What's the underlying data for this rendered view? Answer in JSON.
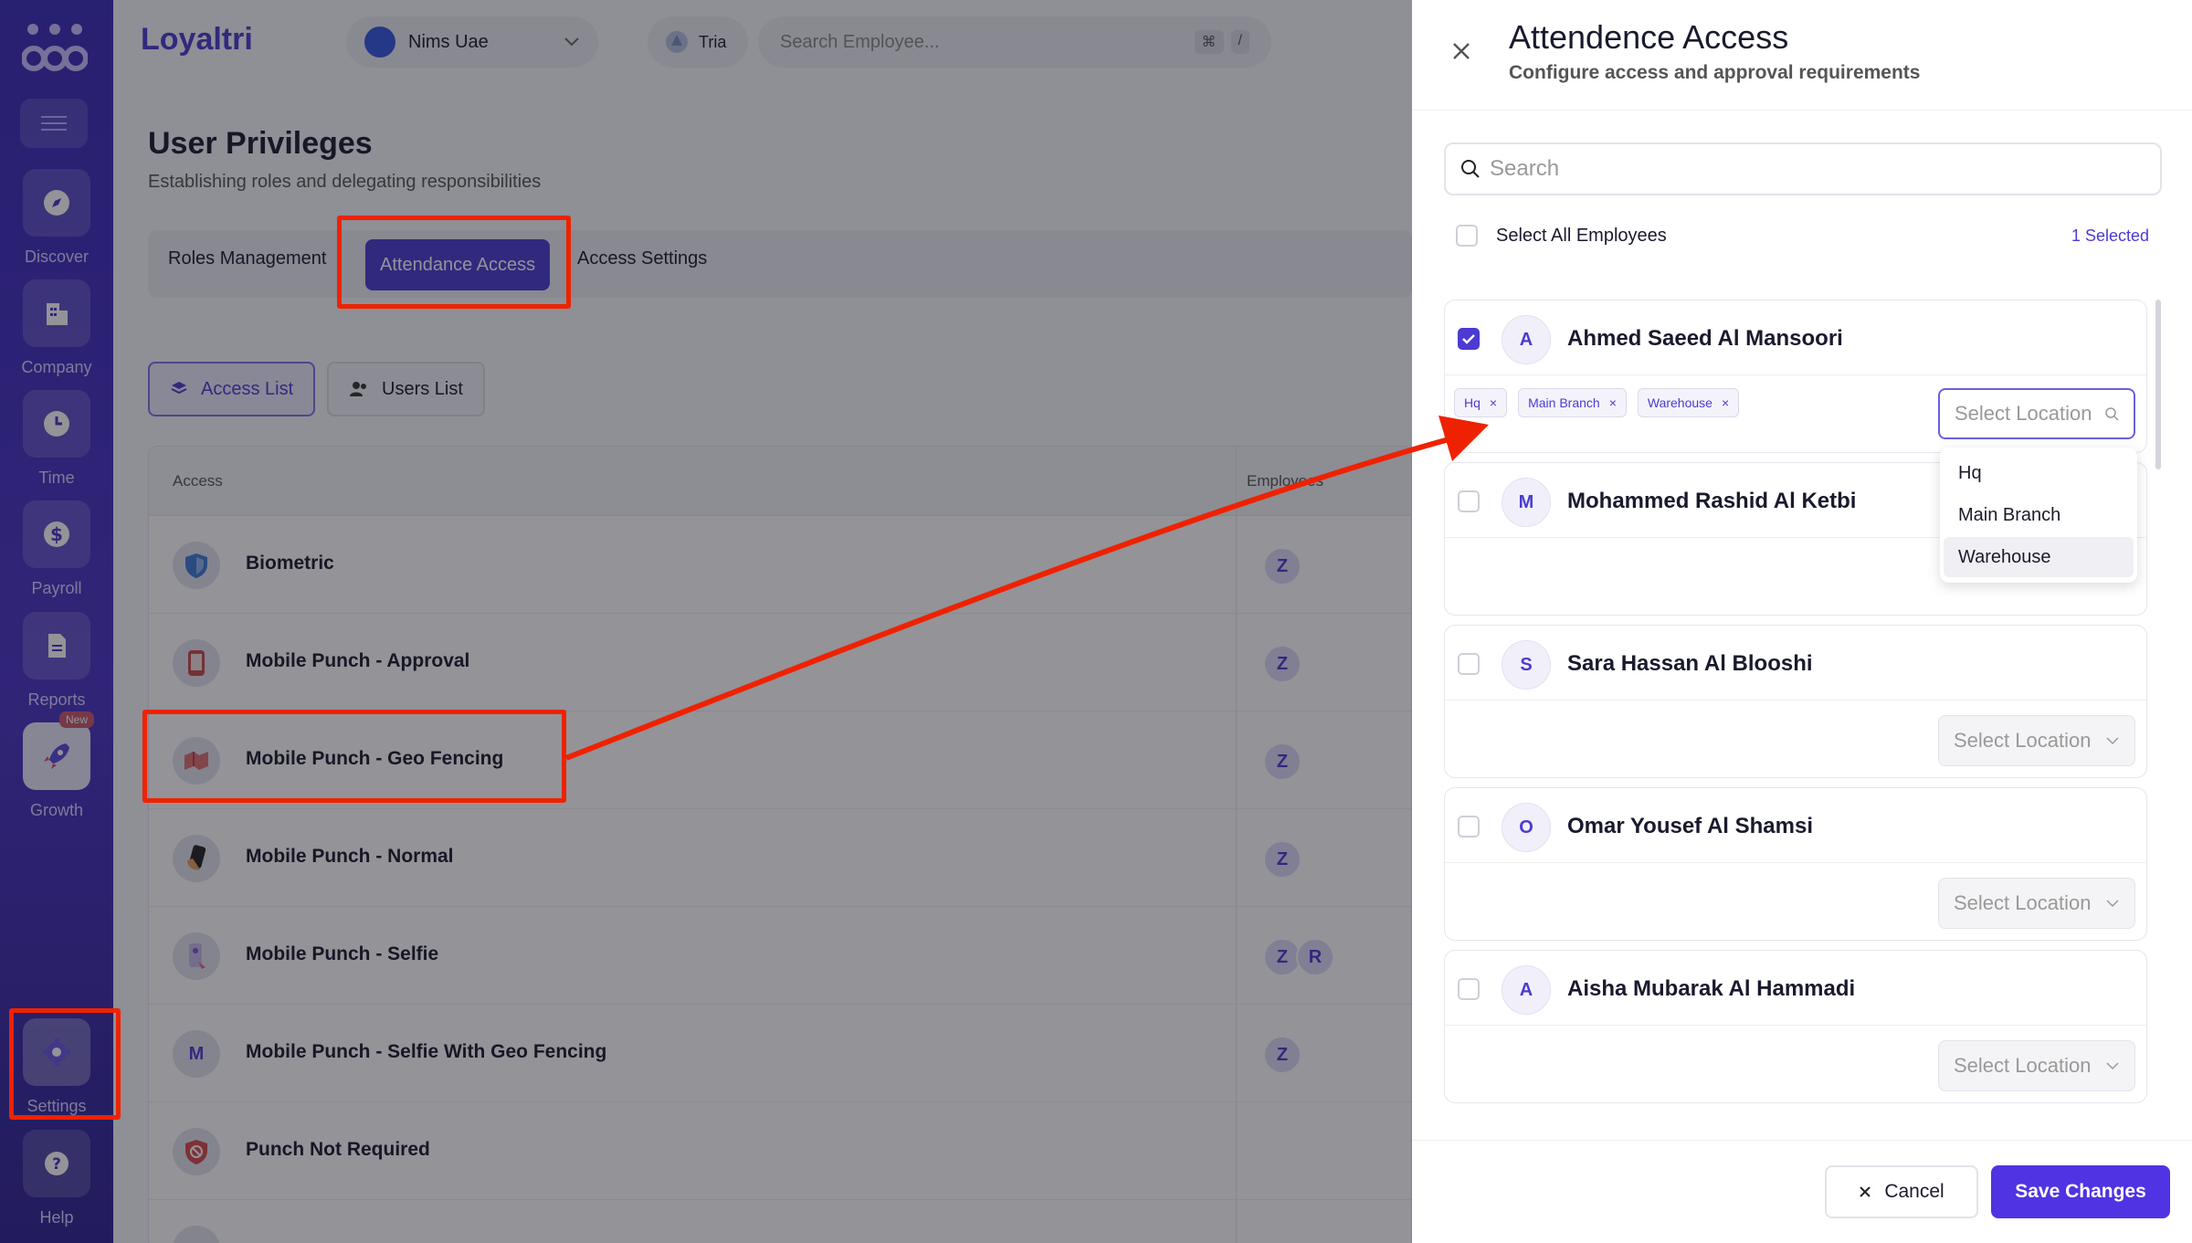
{
  "sidebar": {
    "items": [
      {
        "label": "Discover",
        "icon": "compass-icon"
      },
      {
        "label": "Company",
        "icon": "building-icon"
      },
      {
        "label": "Time",
        "icon": "clock-icon"
      },
      {
        "label": "Payroll",
        "icon": "dollar-icon"
      },
      {
        "label": "Reports",
        "icon": "document-icon"
      },
      {
        "label": "Growth",
        "icon": "rocket-icon",
        "badge": "New"
      },
      {
        "label": "Settings",
        "icon": "gear-icon"
      },
      {
        "label": "Help",
        "icon": "help-icon"
      }
    ]
  },
  "topbar": {
    "brand": "Loyaltri",
    "org": "Nims Uae",
    "user": "Tria",
    "search_placeholder": "Search Employee...",
    "shortcut_1": "⌘",
    "shortcut_2": "/"
  },
  "page": {
    "title": "User Privileges",
    "subtitle": "Establishing roles and delegating responsibilities",
    "tabs": [
      "Roles Management",
      "Attendance Access",
      "Access Settings"
    ],
    "views": [
      "Access List",
      "Users List"
    ],
    "table": {
      "col_access": "Access",
      "col_employees": "Employees",
      "rows": [
        {
          "name": "Biometric",
          "employees": [
            "Z"
          ]
        },
        {
          "name": "Mobile Punch - Approval",
          "employees": [
            "Z"
          ]
        },
        {
          "name": "Mobile Punch - Geo Fencing",
          "employees": [
            "Z"
          ]
        },
        {
          "name": "Mobile Punch - Normal",
          "employees": [
            "Z"
          ]
        },
        {
          "name": "Mobile Punch - Selfie",
          "employees": [
            "Z",
            "R"
          ]
        },
        {
          "name": "Mobile Punch - Selfie With Geo Fencing",
          "initial": "M",
          "employees": [
            "Z"
          ]
        },
        {
          "name": "Punch Not Required",
          "employees": []
        }
      ]
    }
  },
  "drawer": {
    "title": "Attendence Access",
    "subtitle": "Configure access and approval requirements",
    "search_placeholder": "Search",
    "select_all": "Select All Employees",
    "selected_count": "1 Selected",
    "employees": [
      {
        "initial": "A",
        "name": "Ahmed Saeed Al Mansoori",
        "checked": true,
        "chips": [
          "Hq",
          "Main Branch",
          "Warehouse"
        ]
      },
      {
        "initial": "M",
        "name": "Mohammed Rashid Al Ketbi",
        "checked": false
      },
      {
        "initial": "S",
        "name": "Sara Hassan Al Blooshi",
        "checked": false
      },
      {
        "initial": "O",
        "name": "Omar Yousef Al Shamsi",
        "checked": false
      },
      {
        "initial": "A",
        "name": "Aisha Mubarak Al Hammadi",
        "checked": false
      }
    ],
    "location_placeholder": "Select Location",
    "dropdown_options": [
      "Hq",
      "Main Branch",
      "Warehouse"
    ],
    "cancel_label": "Cancel",
    "save_label": "Save Changes"
  },
  "colors": {
    "accent": "#4b3bd0",
    "annotation": "#ee2200",
    "save_button": "#5033e2"
  }
}
